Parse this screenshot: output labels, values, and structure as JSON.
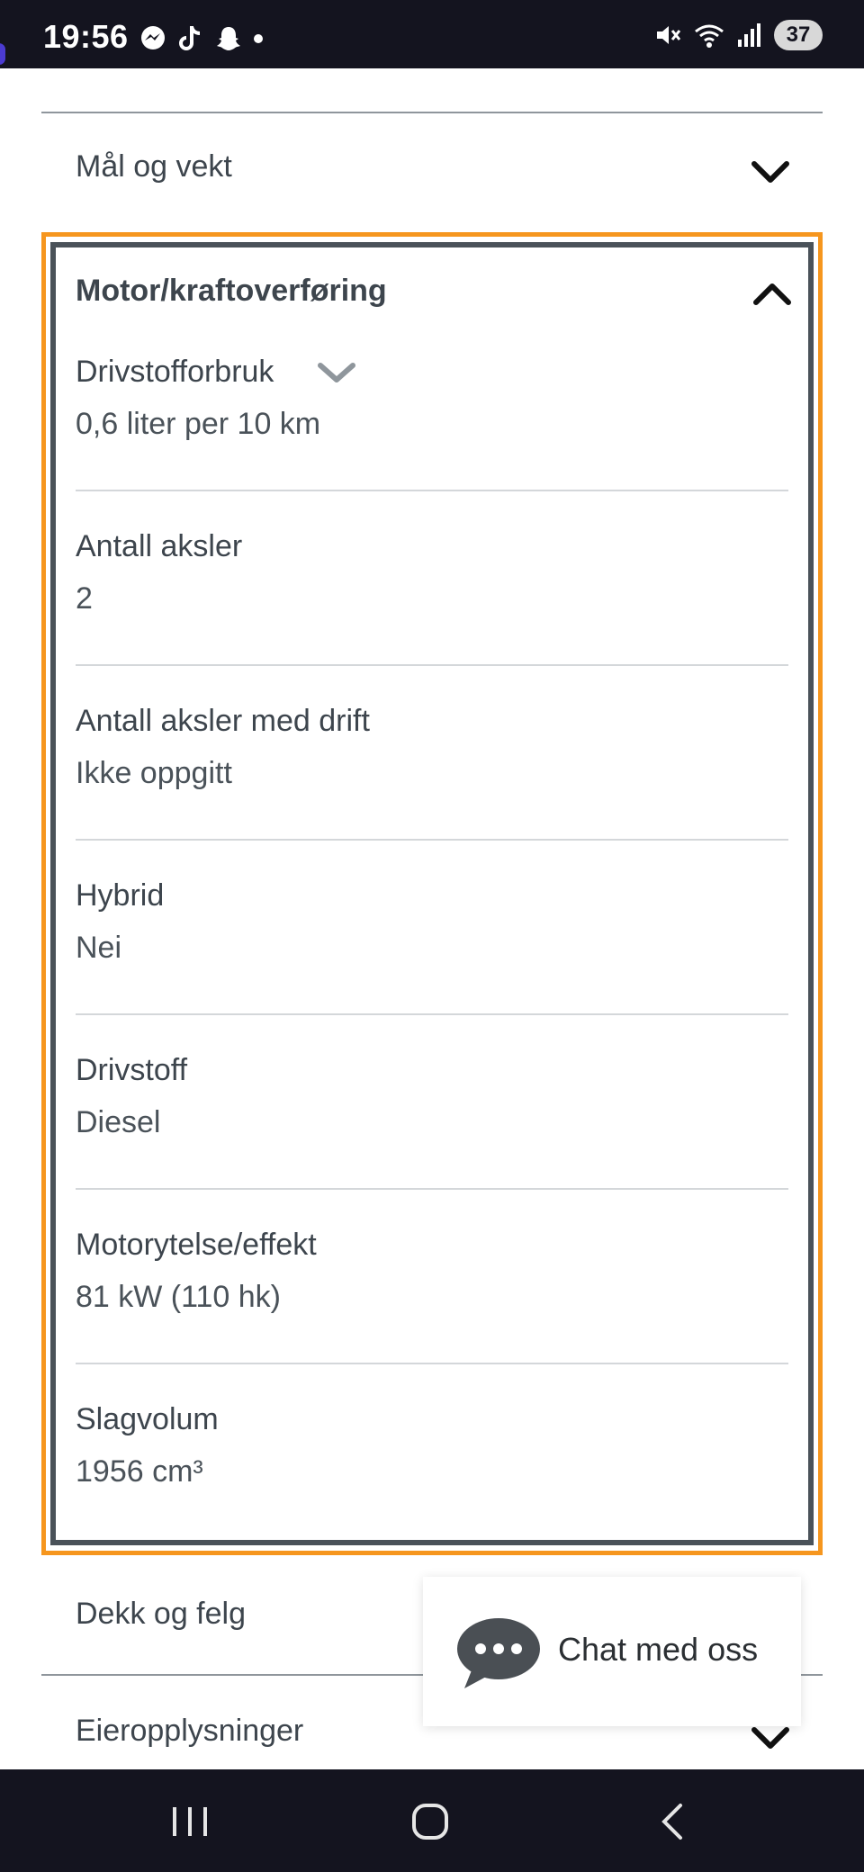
{
  "status_bar": {
    "time": "19:56",
    "battery": "37",
    "left_icons": [
      "messenger-icon",
      "tiktok-icon",
      "snapchat-icon",
      "dot-icon"
    ],
    "right_icons": [
      "mute-icon",
      "wifi-icon",
      "signal-icon",
      "battery-icon"
    ]
  },
  "sections": {
    "mal_og_vekt": "Mål og vekt",
    "motor": "Motor/kraftoverføring",
    "dekk": "Dekk og felg",
    "eier": "Eieropplysninger"
  },
  "specs": [
    {
      "label": "Drivstofforbruk",
      "value": "0,6 liter per 10 km"
    },
    {
      "label": "Antall aksler",
      "value": "2"
    },
    {
      "label": "Antall aksler med drift",
      "value": "Ikke oppgitt"
    },
    {
      "label": "Hybrid",
      "value": "Nei"
    },
    {
      "label": "Drivstoff",
      "value": "Diesel"
    },
    {
      "label": "Motorytelse/effekt",
      "value": "81 kW (110 hk)"
    },
    {
      "label": "Slagvolum",
      "value": "1956 cm³"
    }
  ],
  "chat": {
    "label": "Chat med oss"
  },
  "colors": {
    "highlight": "#f6961e",
    "frame": "#4a5259",
    "text": "#3d454d",
    "bars": "#14141f"
  }
}
